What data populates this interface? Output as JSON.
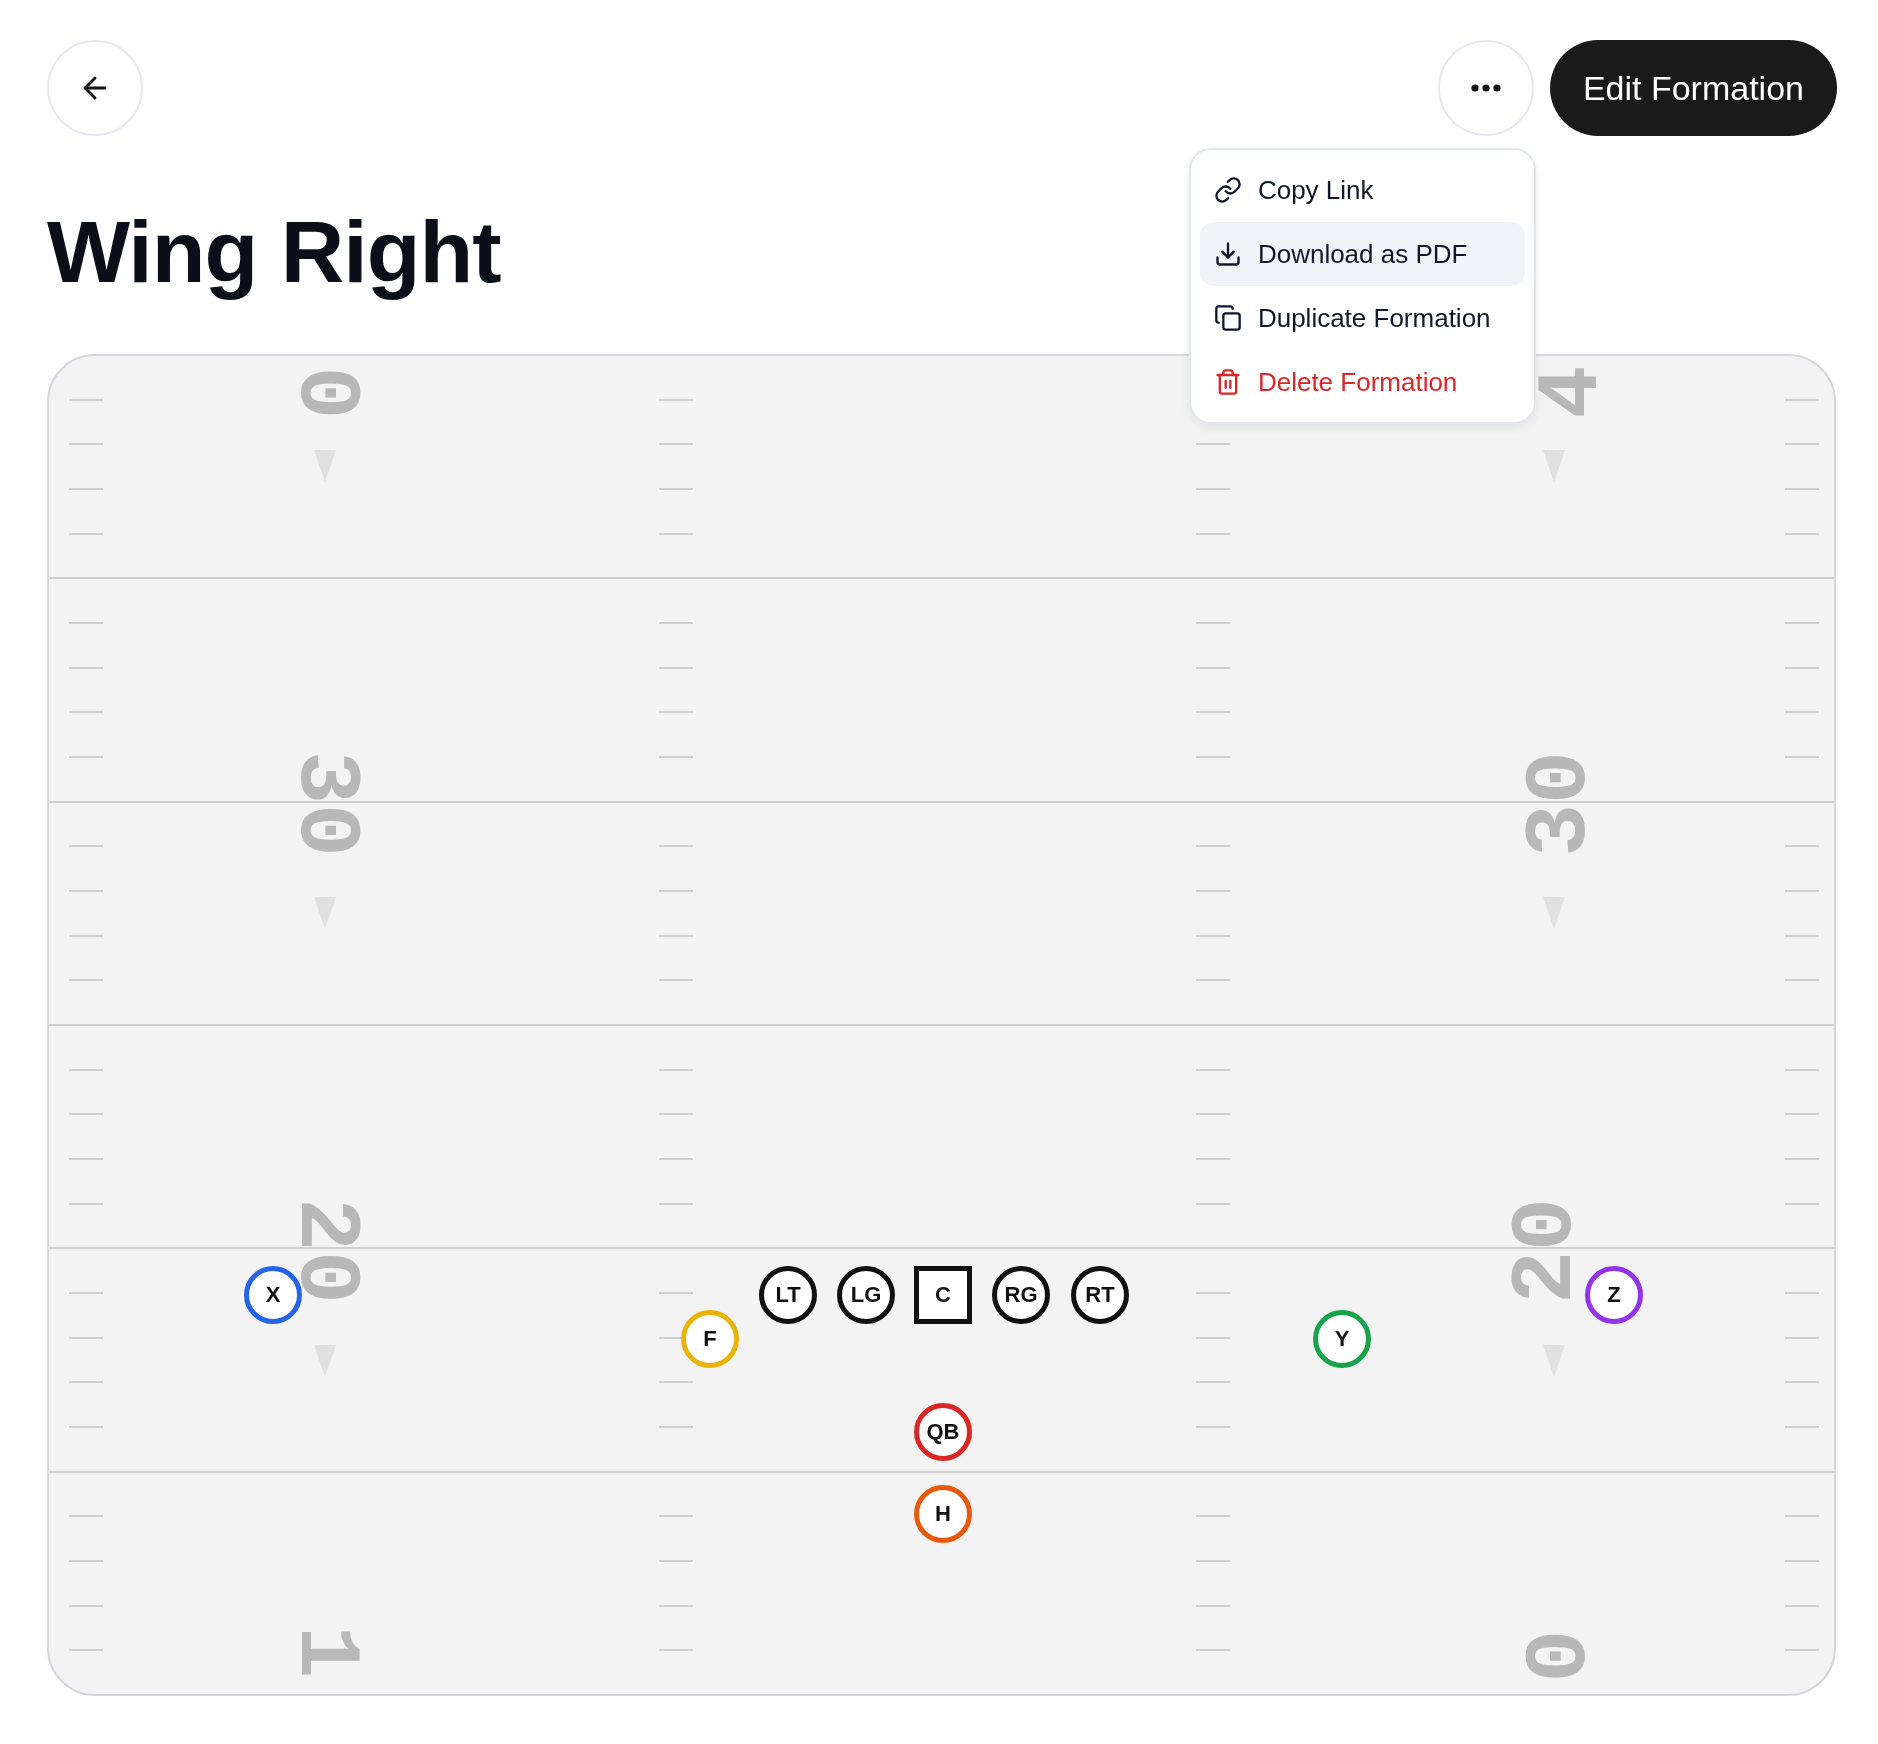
{
  "header": {
    "edit_button": "Edit Formation"
  },
  "title": "Wing Right",
  "menu": {
    "open": true,
    "items": [
      {
        "label": "Copy Link",
        "kind": "default",
        "highlighted": false
      },
      {
        "label": "Download as PDF",
        "kind": "default",
        "highlighted": true
      },
      {
        "label": "Duplicate Formation",
        "kind": "default",
        "highlighted": false
      },
      {
        "label": "Delete Formation",
        "kind": "destructive",
        "highlighted": false
      }
    ]
  },
  "field": {
    "left_numbers": [
      {
        "text": "0"
      },
      {
        "text": "30"
      },
      {
        "text": "20"
      },
      {
        "text": "1"
      }
    ],
    "right_numbers": [
      {
        "text": "4"
      },
      {
        "text": "30"
      },
      {
        "text": "20"
      },
      {
        "text": "0"
      }
    ],
    "players": [
      {
        "label": "X",
        "kind": "circle",
        "color": "#2563eb"
      },
      {
        "label": "LT",
        "kind": "circle",
        "color": "#111111"
      },
      {
        "label": "LG",
        "kind": "circle",
        "color": "#111111"
      },
      {
        "label": "C",
        "kind": "square",
        "color": "#111111"
      },
      {
        "label": "RG",
        "kind": "circle",
        "color": "#111111"
      },
      {
        "label": "RT",
        "kind": "circle",
        "color": "#111111"
      },
      {
        "label": "Z",
        "kind": "circle",
        "color": "#9333ea"
      },
      {
        "label": "F",
        "kind": "circle",
        "color": "#eab308"
      },
      {
        "label": "Y",
        "kind": "circle",
        "color": "#16a34a"
      },
      {
        "label": "QB",
        "kind": "circle",
        "color": "#dc2626"
      },
      {
        "label": "H",
        "kind": "circle",
        "color": "#ea580c"
      }
    ]
  }
}
